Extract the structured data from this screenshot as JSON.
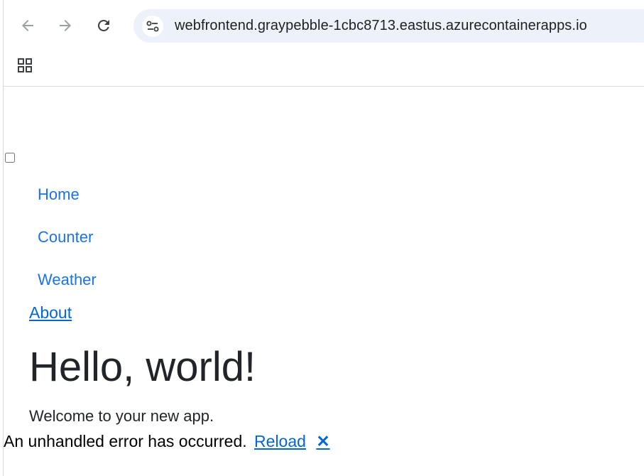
{
  "browser": {
    "url": "webfrontend.graypebble-1cbc8713.eastus.azurecontainerapps.io",
    "icons": {
      "back": "arrow-left-icon",
      "forward": "arrow-right-icon",
      "reload": "reload-icon",
      "site_info": "tune-icon",
      "apps": "apps-grid-icon"
    }
  },
  "nav": {
    "items": [
      {
        "label": "Home"
      },
      {
        "label": "Counter"
      },
      {
        "label": "Weather"
      }
    ]
  },
  "top_row": {
    "about_label": "About"
  },
  "main": {
    "title": "Hello, world!",
    "welcome": "Welcome to your new app."
  },
  "error_ui": {
    "message": "An unhandled error has occurred.",
    "reload_label": "Reload",
    "dismiss_label": "✕"
  },
  "colors": {
    "link_nav": "#1a73e8",
    "link_body": "#0366d6",
    "text": "#212529",
    "omnibox_bg": "#edf2fa"
  }
}
